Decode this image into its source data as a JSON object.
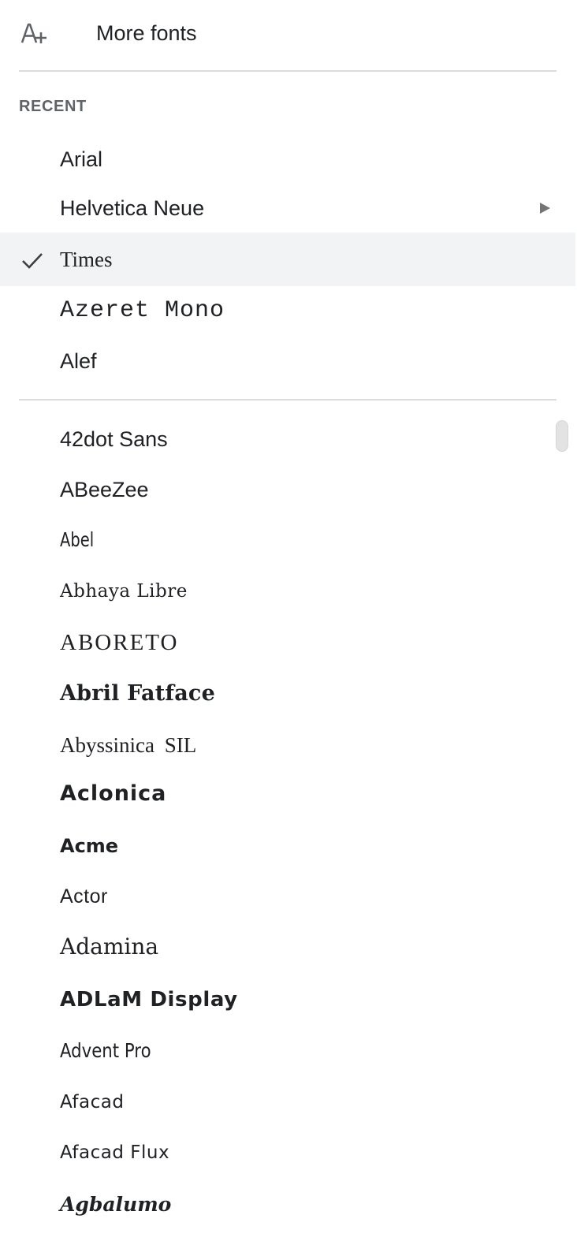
{
  "more_fonts": {
    "icon": "add-font-icon",
    "label": "More fonts"
  },
  "recent": {
    "heading": "RECENT",
    "items": [
      {
        "label": "Arial",
        "selected": false,
        "has_submenu": false
      },
      {
        "label": "Helvetica Neue",
        "selected": false,
        "has_submenu": true
      },
      {
        "label": "Times",
        "selected": true,
        "has_submenu": false
      },
      {
        "label": "Azeret Mono",
        "selected": false,
        "has_submenu": false
      },
      {
        "label": "Alef",
        "selected": false,
        "has_submenu": false
      }
    ]
  },
  "all_fonts": {
    "items": [
      {
        "label": "42dot Sans"
      },
      {
        "label": "ABeeZee"
      },
      {
        "label": "Abel"
      },
      {
        "label": "Abhaya Libre"
      },
      {
        "label": "ABORETO"
      },
      {
        "label": "Abril Fatface"
      },
      {
        "label": "Abyssinica SIL"
      },
      {
        "label": "Aclonica"
      },
      {
        "label": "Acme"
      },
      {
        "label": "Actor"
      },
      {
        "label": "Adamina"
      },
      {
        "label": "ADLaM Display"
      },
      {
        "label": "Advent Pro"
      },
      {
        "label": "Afacad"
      },
      {
        "label": "Afacad Flux"
      },
      {
        "label": "Agbalumo"
      }
    ]
  },
  "icons": {
    "check": "check-icon",
    "submenu": "submenu-arrow-icon"
  },
  "colors": {
    "selected_background": "#f1f3f4",
    "divider": "#dadce0",
    "heading": "#5f6368",
    "text": "#202124"
  }
}
